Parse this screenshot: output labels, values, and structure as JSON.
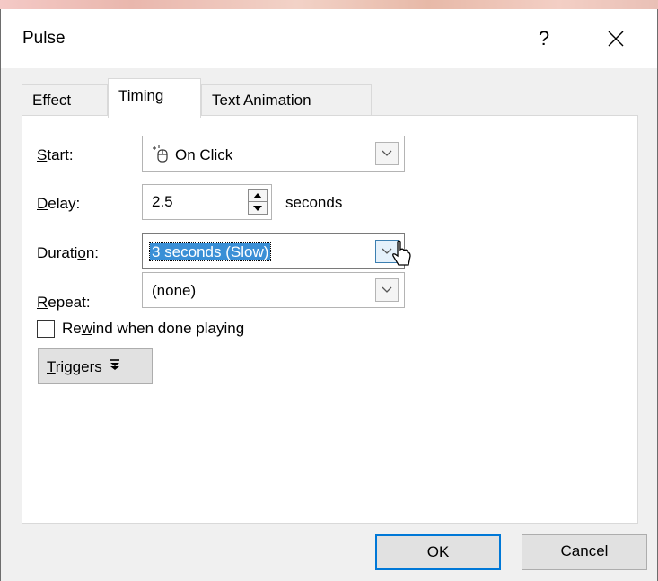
{
  "dialog": {
    "title": "Pulse",
    "help_label": "?",
    "close_icon": "close-icon"
  },
  "tabs": [
    {
      "label": "Effect",
      "active": false
    },
    {
      "label": "Timing",
      "active": true
    },
    {
      "label": "Text Animation",
      "active": false
    }
  ],
  "timing": {
    "start": {
      "label_pre": "",
      "label_u": "S",
      "label_post": "tart:",
      "value": "On Click",
      "icon": "mouse-click-icon"
    },
    "delay": {
      "label_pre": "",
      "label_u": "D",
      "label_post": "elay:",
      "value": "2.5",
      "unit": "seconds"
    },
    "duration": {
      "label_pre": "Durati",
      "label_u": "o",
      "label_post": "n:",
      "value": "3 seconds (Slow)"
    },
    "repeat": {
      "label_pre": "",
      "label_u": "R",
      "label_post": "epeat:",
      "value": "(none)"
    },
    "rewind": {
      "label_pre": "Re",
      "label_u": "w",
      "label_post": "ind when done playing",
      "checked": false
    }
  },
  "triggers": {
    "label_u": "T",
    "label_post": "riggers"
  },
  "buttons": {
    "ok": "OK",
    "cancel": "Cancel"
  },
  "colors": {
    "accent": "#0078d7",
    "selection": "#3a8fd6"
  }
}
